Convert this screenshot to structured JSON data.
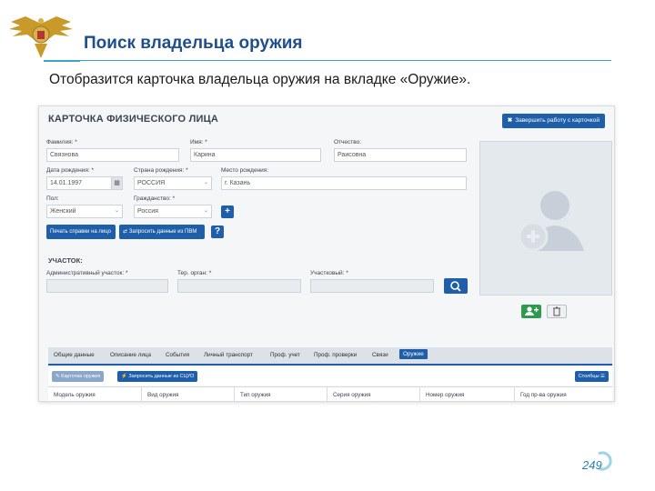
{
  "slide": {
    "title": "Поиск владельца оружия",
    "subtitle": "Отобразится карточка владельца оружия на вкладке «Оружие».",
    "page_number": "249"
  },
  "card": {
    "title": "КАРТОЧКА ФИЗИЧЕСКОГО ЛИЦА",
    "finish_button": "Завершить работу с карточкой",
    "fields": {
      "surname": {
        "label": "Фамилия: *",
        "value": "Связнова"
      },
      "name": {
        "label": "Имя: *",
        "value": "Карина"
      },
      "patronymic": {
        "label": "Отчество:",
        "value": "Раисовна"
      },
      "birth_date": {
        "label": "Дата рождения: *",
        "value": "14.01.1997"
      },
      "birth_country": {
        "label": "Страна рождения: *",
        "value": "РОССИЯ"
      },
      "birth_place": {
        "label": "Место рождения:",
        "value": "г. Казань"
      },
      "gender": {
        "label": "Пол:",
        "value": "Женский"
      },
      "citizenship": {
        "label": "Гражданство: *",
        "value": "Россия"
      }
    },
    "buttons": {
      "print": "Печать справки на лицо",
      "request_pvm": "Запросить данные из ПВМ",
      "help": "?",
      "add": "+"
    },
    "district": {
      "title": "УЧАСТОК:",
      "admin_label": "Административный участок: *",
      "ter_label": "Тер. орган: *",
      "district_label": "Участковый: *"
    },
    "tabs": [
      {
        "label": "Общие данные"
      },
      {
        "label": "Описание лица"
      },
      {
        "label": "События"
      },
      {
        "label": "Личный транспорт"
      },
      {
        "label": "Проф. учет"
      },
      {
        "label": "Проф. проверки"
      },
      {
        "label": "Связи"
      },
      {
        "label": "Оружие"
      }
    ],
    "toolbar": {
      "weapon_card": "Карточка оружия",
      "request_scuo": "Запросить данные из СЦУО",
      "columns": "Столбцы"
    },
    "table_headers": [
      "Модель оружия",
      "Вид оружия",
      "Тип оружия",
      "Серия оружия",
      "Номер оружия",
      "Год пр-ва оружия"
    ]
  }
}
